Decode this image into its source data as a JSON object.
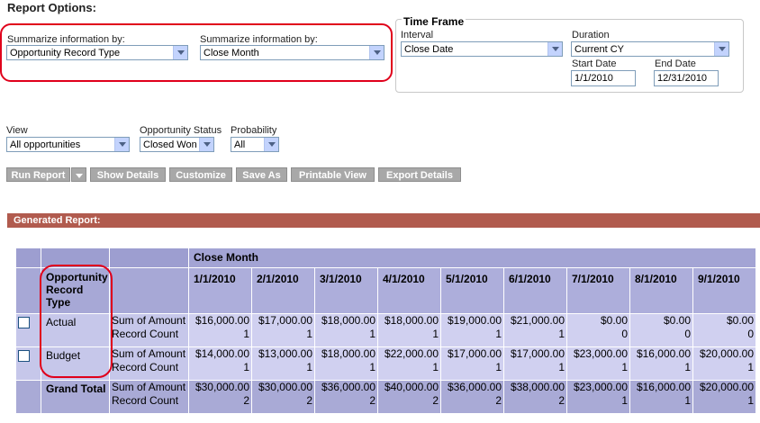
{
  "report_options": {
    "title": "Report Options:"
  },
  "summarize": [
    {
      "label": "Summarize information by:",
      "value": "Opportunity Record Type"
    },
    {
      "label": "Summarize information by:",
      "value": "Close Month"
    }
  ],
  "time_frame": {
    "title": "Time Frame",
    "interval_label": "Interval",
    "interval_value": "Close Date",
    "duration_label": "Duration",
    "duration_value": "Current CY",
    "start_label": "Start Date",
    "start_value": "1/1/2010",
    "end_label": "End Date",
    "end_value": "12/31/2010"
  },
  "filters": {
    "view_label": "View",
    "view_value": "All opportunities",
    "status_label": "Opportunity Status",
    "status_value": "Closed Won",
    "prob_label": "Probability",
    "prob_value": "All"
  },
  "buttons": {
    "run": "Run Report",
    "details": "Show Details",
    "customize": "Customize",
    "save_as": "Save As",
    "printable": "Printable View",
    "export": "Export Details"
  },
  "generated": {
    "title": "Generated Report:"
  },
  "report": {
    "group_header": "Close Month",
    "row_header": "Opportunity Record Type",
    "dates": [
      "1/1/2010",
      "2/1/2010",
      "3/1/2010",
      "4/1/2010",
      "5/1/2010",
      "6/1/2010",
      "7/1/2010",
      "8/1/2010",
      "9/1/2010"
    ],
    "metric_labels": [
      "Sum of Amount",
      "Record Count"
    ],
    "rows": [
      {
        "name": "Actual",
        "amounts": [
          "$16,000.00",
          "$17,000.00",
          "$18,000.00",
          "$18,000.00",
          "$19,000.00",
          "$21,000.00",
          "$0.00",
          "$0.00",
          "$0.00"
        ],
        "counts": [
          "1",
          "1",
          "1",
          "1",
          "1",
          "1",
          "0",
          "0",
          "0"
        ]
      },
      {
        "name": "Budget",
        "amounts": [
          "$14,000.00",
          "$13,000.00",
          "$18,000.00",
          "$22,000.00",
          "$17,000.00",
          "$17,000.00",
          "$23,000.00",
          "$16,000.00",
          "$20,000.00"
        ],
        "counts": [
          "1",
          "1",
          "1",
          "1",
          "1",
          "1",
          "1",
          "1",
          "1"
        ]
      }
    ],
    "grand_total": {
      "name": "Grand Total",
      "amounts": [
        "$30,000.00",
        "$30,000.00",
        "$36,000.00",
        "$40,000.00",
        "$36,000.00",
        "$38,000.00",
        "$23,000.00",
        "$16,000.00",
        "$20,000.00"
      ],
      "counts": [
        "2",
        "2",
        "2",
        "2",
        "2",
        "2",
        "1",
        "1",
        "1"
      ]
    }
  },
  "colors": {
    "annotation": "#e0001b",
    "report_bar": "#b15b4e",
    "button": "#a8a8a8"
  }
}
